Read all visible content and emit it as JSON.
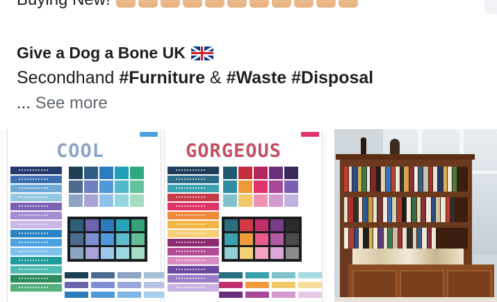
{
  "post": {
    "previous_text": "Buying New!",
    "page_name": "Give a Dog a Bone UK",
    "text_plain_1": "Secondhand ",
    "tag_1": "#Furniture",
    "text_plain_2": " & ",
    "tag_2": "#Waste",
    "text_plain_3": " ",
    "tag_3": "#Disposal",
    "ellipsis": "...",
    "see_more": "See more"
  },
  "images": {
    "left": {
      "panel_1_title": "COOL",
      "panel_2_title": "GORGEOUS"
    }
  },
  "icons": {
    "thumbs": "thumbs-up-emoji",
    "flag": "uk-flag-emoji"
  },
  "colors": {
    "cool_accent": "#4aa3df",
    "gorgeous_accent": "#e0336a"
  }
}
